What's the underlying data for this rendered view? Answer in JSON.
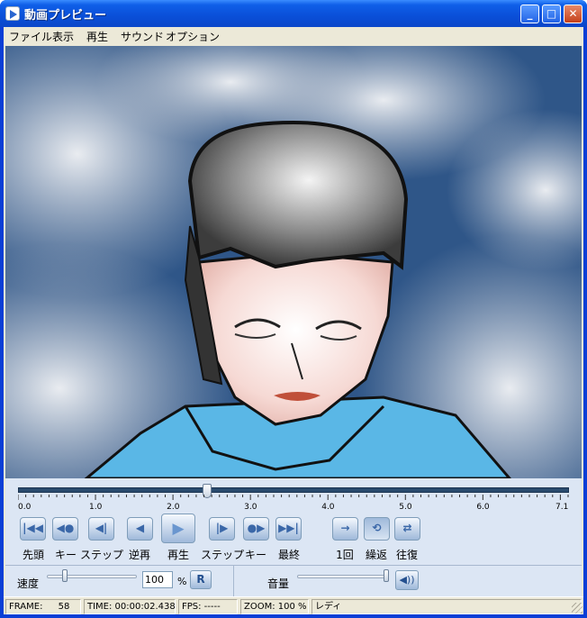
{
  "window": {
    "title": "動画プレビュー",
    "minimize_label": "_",
    "maximize_label": "□",
    "close_label": "✕"
  },
  "menu": [
    "ファイル",
    "表示",
    "再生",
    "サウンド",
    "オプション"
  ],
  "seekbar": {
    "tick_labels": [
      "0.0",
      "1.0",
      "2.0",
      "3.0",
      "4.0",
      "5.0",
      "6.0",
      "7.1"
    ],
    "position_seconds": 2.438,
    "duration_seconds": 7.1
  },
  "transport": [
    {
      "id": "first",
      "label": "先頭",
      "icon": "skip-to-start-icon"
    },
    {
      "id": "key-back",
      "label": "キー",
      "icon": "previous-key-icon"
    },
    {
      "id": "step-back",
      "label": "ステップ",
      "icon": "step-back-icon"
    },
    {
      "id": "reverse",
      "label": "逆再",
      "icon": "reverse-play-icon"
    },
    {
      "id": "play",
      "label": "再生",
      "icon": "play-icon"
    },
    {
      "id": "step-forward",
      "label": "ステップ",
      "icon": "step-forward-icon"
    },
    {
      "id": "key-forward",
      "label": "キー",
      "icon": "next-key-icon"
    },
    {
      "id": "last",
      "label": "最終",
      "icon": "skip-to-end-icon"
    }
  ],
  "loop_modes": [
    {
      "id": "once",
      "label": "1回",
      "icon": "play-once-icon"
    },
    {
      "id": "repeat",
      "label": "繰返",
      "icon": "repeat-icon",
      "active": true
    },
    {
      "id": "pingpong",
      "label": "往復",
      "icon": "ping-pong-icon"
    }
  ],
  "speed": {
    "label": "速度",
    "value": "100",
    "unit": "%",
    "reset_label": "R"
  },
  "volume": {
    "label": "音量",
    "button_glyph": "◀))"
  },
  "status": {
    "frame_label": "FRAME:",
    "frame_value": "58",
    "time": "TIME: 00:00:02.438",
    "fps": "FPS: -----",
    "zoom": "ZOOM: 100 %",
    "state": "レディ"
  },
  "colors": {
    "titlebar": "#0a4fd8",
    "controls_bg": "#dce6f4",
    "sky": "#2a4e86",
    "shirt": "#5ab7e6"
  }
}
